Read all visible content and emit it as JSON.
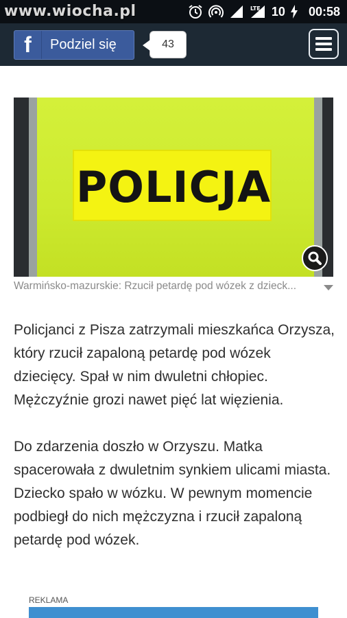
{
  "status_bar": {
    "watermark": "www.wiocha.pl",
    "battery": "10",
    "time": "00:58",
    "icons": [
      "alarm-icon",
      "hotspot-icon",
      "signal-icon",
      "lte-signal-icon",
      "charging-icon"
    ]
  },
  "share_bar": {
    "fb_icon": "f",
    "share_label": "Podziel się",
    "share_count": "43",
    "menu_icon": "hamburger-icon"
  },
  "article": {
    "photo": {
      "patch_text": "POLICJA",
      "zoom_icon": "magnifier-icon"
    },
    "caption": "Warmińsko-mazurskie: Rzucił petardę pod wózek z dzieck...",
    "paragraphs": [
      "Policjanci z Pisza zatrzymali mieszkańca Orzysza, który rzucił zapaloną petardę pod wózek dziecięcy. Spał w nim dwuletni chłopiec. Mężczyźnie grozi nawet pięć lat więzienia.",
      "Do zdarzenia doszło w Orzyszu. Matka spacerowała z dwuletnim synkiem ulicami miasta. Dziecko spało w wózku. W pewnym momencie podbiegł do nich mężczyzna i rzucił zapaloną petardę pod wózek."
    ]
  },
  "ad": {
    "label": "REKLAMA"
  },
  "colors": {
    "status_bg": "#0b0f14",
    "share_bar_bg": "#1d2934",
    "facebook_blue": "#3b5b9c",
    "vest_yellow": "#cdea2e",
    "text": "#2f2f2f",
    "caption": "#8a8a8a"
  }
}
